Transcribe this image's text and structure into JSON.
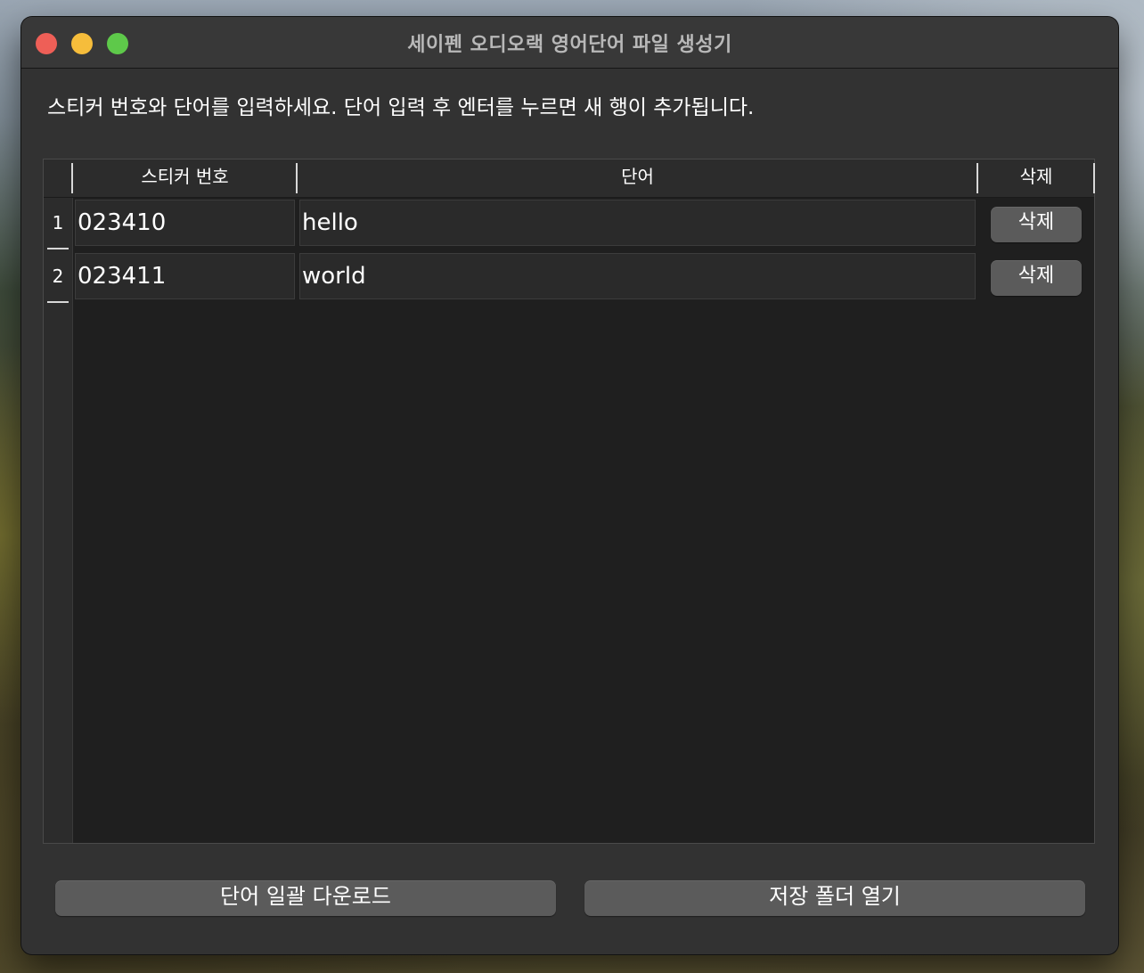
{
  "window": {
    "title": "세이펜 오디오랙 영어단어 파일 생성기"
  },
  "instruction": "스티커 번호와 단어를 입력하세요. 단어 입력 후 엔터를 누르면 새 행이 추가됩니다.",
  "table": {
    "columns": [
      "스티커 번호",
      "단어",
      "삭제"
    ],
    "rows": [
      {
        "num": "1",
        "sticker": "023410",
        "word": "hello",
        "delete_label": "삭제"
      },
      {
        "num": "2",
        "sticker": "023411",
        "word": "world",
        "delete_label": "삭제"
      }
    ]
  },
  "buttons": {
    "download_all": "단어 일괄 다운로드",
    "open_folder": "저장 폴더 열기"
  },
  "colors": {
    "close": "#ee5f57",
    "minimize": "#f6bd3b",
    "maximize": "#5ec94a",
    "window_bg": "#323232",
    "table_bg": "#1f1f1f",
    "button_bg": "#5b5b5b"
  }
}
